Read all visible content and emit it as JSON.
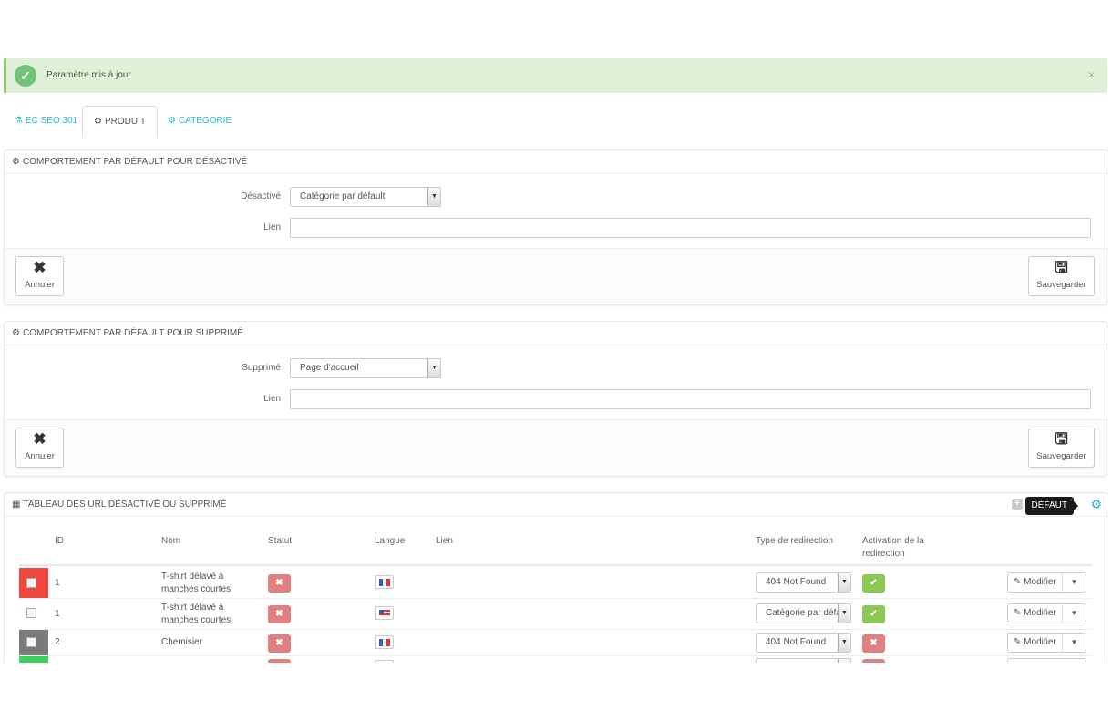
{
  "alert": {
    "message": "Paramètre mis à jour",
    "close": "×",
    "icon": "check-circle-icon"
  },
  "tabs": [
    {
      "label": "EC SEO 301",
      "icon": "flask-icon",
      "active": false
    },
    {
      "label": "PRODUIT",
      "icon": "cogs-icon",
      "active": true
    },
    {
      "label": "CATEGORIE",
      "icon": "cogs-icon",
      "active": false
    }
  ],
  "panel_disabled": {
    "title": "COMPORTEMENT PAR DÉFAULT POUR DÉSACTIVÉ",
    "select_label": "Désactivé",
    "select_value": "Catégorie par défault",
    "link_label": "Lien",
    "link_value": "",
    "cancel_label": "Annuler",
    "save_label": "Sauvegarder"
  },
  "panel_deleted": {
    "title": "COMPORTEMENT PAR DÉFAULT POUR SUPPRIMÉ",
    "select_label": "Supprimé",
    "select_value": "Page d'accueil",
    "link_label": "Lien",
    "link_value": "",
    "cancel_label": "Annuler",
    "save_label": "Sauvegarder"
  },
  "table_panel": {
    "title": "TABLEAU DES URL DÉSACTIVÉ OU SUPPRIMÉ",
    "tooltip": "DÉFAUT",
    "columns": [
      "ID",
      "Nom",
      "Statut",
      "Langue",
      "Lien",
      "Type de redirection",
      "Activation de la redirection"
    ],
    "rows": [
      {
        "color": "#f0483e",
        "id": "1",
        "name": "T-shirt délavé à manches courtes",
        "status": "disabled",
        "lang": "fr",
        "link": "",
        "redirect": "404 Not Found",
        "active": true,
        "action": "Modifier"
      },
      {
        "color": "",
        "id": "1",
        "name": "T-shirt délavé à manches courtes",
        "status": "disabled",
        "lang": "en",
        "link": "",
        "redirect": "Catégorie par défault",
        "active": true,
        "action": "Modifier"
      },
      {
        "color": "#7a7a7a",
        "id": "2",
        "name": "Chemisier",
        "status": "disabled",
        "lang": "fr",
        "link": "",
        "redirect": "404 Not Found",
        "active": false,
        "action": "Modifier"
      },
      {
        "color": "#3cd160",
        "id": "",
        "name": "",
        "status": "disabled",
        "lang": "",
        "link": "",
        "redirect": "",
        "active": false,
        "action": ""
      }
    ]
  }
}
